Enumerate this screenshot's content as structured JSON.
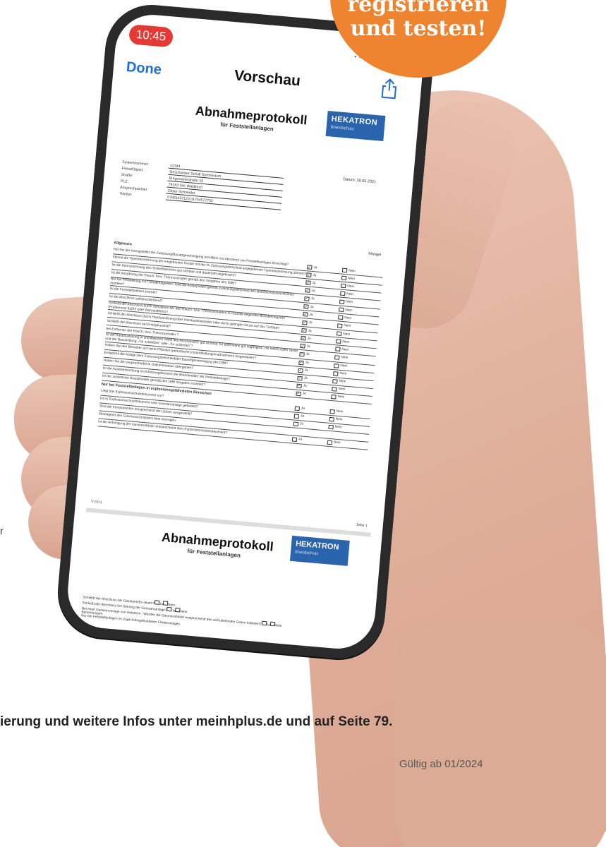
{
  "badge": {
    "line1": "registrieren",
    "line2": "und testen!"
  },
  "status": {
    "time": "10:45",
    "icons": ".ıl ᯤ ▭"
  },
  "nav": {
    "done": "Done",
    "title": "Vorschau"
  },
  "doc": {
    "title": "Abnahmeprotokoll",
    "subtitle": "für Feststellanlagen",
    "logo": {
      "brand": "HEKATRON",
      "tagline": "Brandschutz"
    },
    "fields": [
      {
        "label": "Systemnummer:",
        "value": "12344"
      },
      {
        "label": "Firma/Objekt:",
        "value": "Geschwister Scholl Gymnasium"
      },
      {
        "label": "Straße:",
        "value": "Bürgerwehrstraße 10"
      },
      {
        "label": "PLZ:",
        "value": "79183     Ort:   Waldkirch"
      },
      {
        "label": "Ansprechpartner:",
        "value": "Dieter Schneider"
      },
      {
        "label": "Telefon:",
        "value": "07681457123 01754577732"
      }
    ],
    "datum": "Datum:   28.05.2021",
    "mangel": "Mangel",
    "section1": "Allgemein",
    "ja": "Ja",
    "nein": "Nein",
    "questions": [
      {
        "t": "Hat Sie der Antragsteller der Zulassung/Bauartgenehmigung schriftlich zur Abnahme von Feststellanlagen berechtigt?",
        "ja": true
      },
      {
        "t": "Stimmt die Typenbezeichnung der eingebauten Geräte mit der im Zulassungsbescheid angegebenen Typenbezeichnung überein?",
        "ja": true
      },
      {
        "t": "Ist die Kennzeichnung des Schließbereichs gut sichtbar und dauerhaft angebracht?",
        "ja": true
      },
      {
        "t": "Ist die Anordnung der Rauch- bzw. Thermoschalter gemäß den Vorgaben des DIBt?",
        "ja": true
      },
      {
        "t": "Nur bei Feststellung mit Türhaftmagneten: Sind die Ankerplatten gemäß Zulassungsbescheid des Brandschutzabschlusses montiert?",
        "ja": true
      },
      {
        "t": "Ist die Feststellfunktion korrekt?",
        "ja": true
      },
      {
        "t": "Ist der Abschluss selbstschließend?",
        "ja": true
      },
      {
        "t": "Schließt der Abschluss durch Simulation der den Rauch- bzw. Thermoschaltern zu Grunde liegenden Brandkenngröße (Prüfaerosol 918/S oder Warmluftföhn)?",
        "ja": true
      },
      {
        "t": "Schließt der Abschluss durch Handauslösung über Handauslösetaster oder durch geringen Druck auf das Türblatt?",
        "ja": true
      },
      {
        "t": "Schließt der Abschluss bei Energieausfall?",
        "ja": true
      },
      {
        "t": "bei Entfernen der Rauch- bzw. Thermoschalter ?",
        "ja": true
      },
      {
        "t": "Ist die Handauslösung in unmittelbarer Nähe des Abschlusses, gut sichtbar, für jedermann gut zugänglich, mit einem roten Taster und der Beschriftung „Tür schließen“ oder „Tor schließen“?",
        "ja": true
      },
      {
        "t": "Haben Sie den Betreiber auf seine Pflichten (periodische Instandhaltungsmaßnahmen) hingewiesen?",
        "ja": true
      },
      {
        "t": "Entspricht die Anlage dem Zulassungsbescheid/der Bauartgenehmigung des DIBt?",
        "ja": true
      },
      {
        "t": "Haben Sie die vorgeschriebene Dokumentation übergeben?",
        "ja": true
      },
      {
        "t": "Ist die Auslöseinrichtung im Erfassungsbereich der Brandmelder der Feststellanlage?",
        "ja": true
      },
      {
        "t": "Ist der zusätzliche Brandmelder gemäß den DIBt Vorgaben montiert?",
        "ja": true
      }
    ],
    "section2": "Nur bei Feststellanlagen in explosionsgefährdeten Bereichen",
    "questions2": [
      {
        "t": "Liegt das Explosionsschutzdokument vor?",
        "ja": false
      },
      {
        "t": "Ist im Explosionsschutzdokument eine Gaswarnanlage gefordert?",
        "ja": false
      },
      {
        "t": "Sind die Komponenten entsprechend den Zonen ausgewählt?",
        "ja": false
      },
      {
        "t": "Montageort des Gasmesscomputers bitte eintragen:",
        "ja": null
      },
      {
        "t": "Ist die Anbringung der Gasmessfühler entsprechend dem Explosionsschutzdokument?",
        "ja": false
      }
    ],
    "version": "V 0.0.1",
    "page": "Seite 1",
    "page2_questions": [
      {
        "t": "Schließt der Abschluss bei Gasalarm/Ex-Alarm?",
        "ja": false
      },
      {
        "t": "Schließt der Abschluss bei Störung der Gaswarnanlage?",
        "ja": false
      },
      {
        "t": "Bei einer Gaswarnanlage von Hekatron : Wurden die Gasmessfühler entsprechend den aufzuleitenden Gasen kalibriert?",
        "ja": false
      },
      {
        "t": "Bemerkungen:",
        "ja": null
      }
    ],
    "page2_section": "Nur bei Feststellanlagen im Zuge bahngebundener Förderanlagen"
  },
  "footer": {
    "promo": "ierung und weitere Infos unter meinhplus.de und auf Seite 79.",
    "valid": "Gültig ab 01/2024",
    "stray": "r"
  }
}
